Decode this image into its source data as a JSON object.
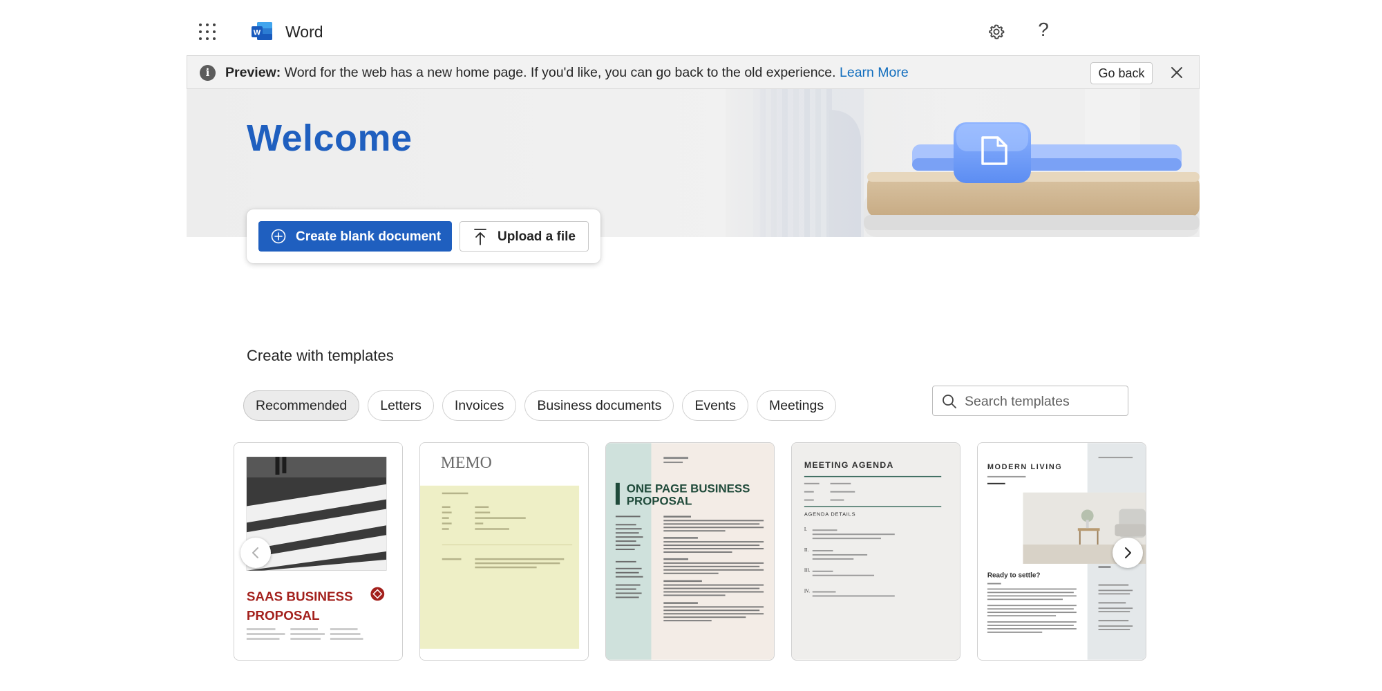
{
  "app": {
    "name": "Word"
  },
  "banner": {
    "prefix": "Preview:",
    "message": "Word for the web has a new home page. If you'd like, you can go back to the old experience.",
    "link": "Learn More",
    "goback": "Go back"
  },
  "hero": {
    "welcome": "Welcome"
  },
  "actions": {
    "create": "Create blank document",
    "upload": "Upload a file"
  },
  "templates": {
    "title": "Create with templates",
    "chips": [
      "Recommended",
      "Letters",
      "Invoices",
      "Business documents",
      "Events",
      "Meetings"
    ],
    "active_chip": "Recommended",
    "search_placeholder": "Search templates",
    "cards": [
      {
        "name": "saas-business-proposal",
        "title_line1": "SAAS BUSINESS",
        "title_line2": "PROPOSAL"
      },
      {
        "name": "memo",
        "title": "MEMO"
      },
      {
        "name": "one-page-business-proposal",
        "title_line1": "ONE PAGE BUSINESS",
        "title_line2": "PROPOSAL"
      },
      {
        "name": "meeting-agenda",
        "title": "MEETING AGENDA",
        "subheading": "AGENDA DETAILS",
        "items": [
          "I.",
          "II.",
          "III.",
          "IV."
        ]
      },
      {
        "name": "modern-living",
        "title": "MODERN LIVING",
        "headline": "Ready to settle?"
      }
    ]
  },
  "colors": {
    "accent": "#1f5fbf",
    "link": "#0f6cbd",
    "saas_red": "#a3201c",
    "proposal_green": "#1f4a3a",
    "memo_yellow": "#eeefc6",
    "proposal_teal": "#cfe1dc"
  },
  "icons": {
    "waffle": "app-launcher-icon",
    "logo": "word-logo-icon",
    "settings": "gear-icon",
    "help": "help-icon",
    "info": "info-icon",
    "close": "close-icon",
    "create": "plus-circle-icon",
    "upload": "upload-icon",
    "search": "search-icon",
    "prev": "chevron-left-icon",
    "next": "chevron-right-icon"
  }
}
